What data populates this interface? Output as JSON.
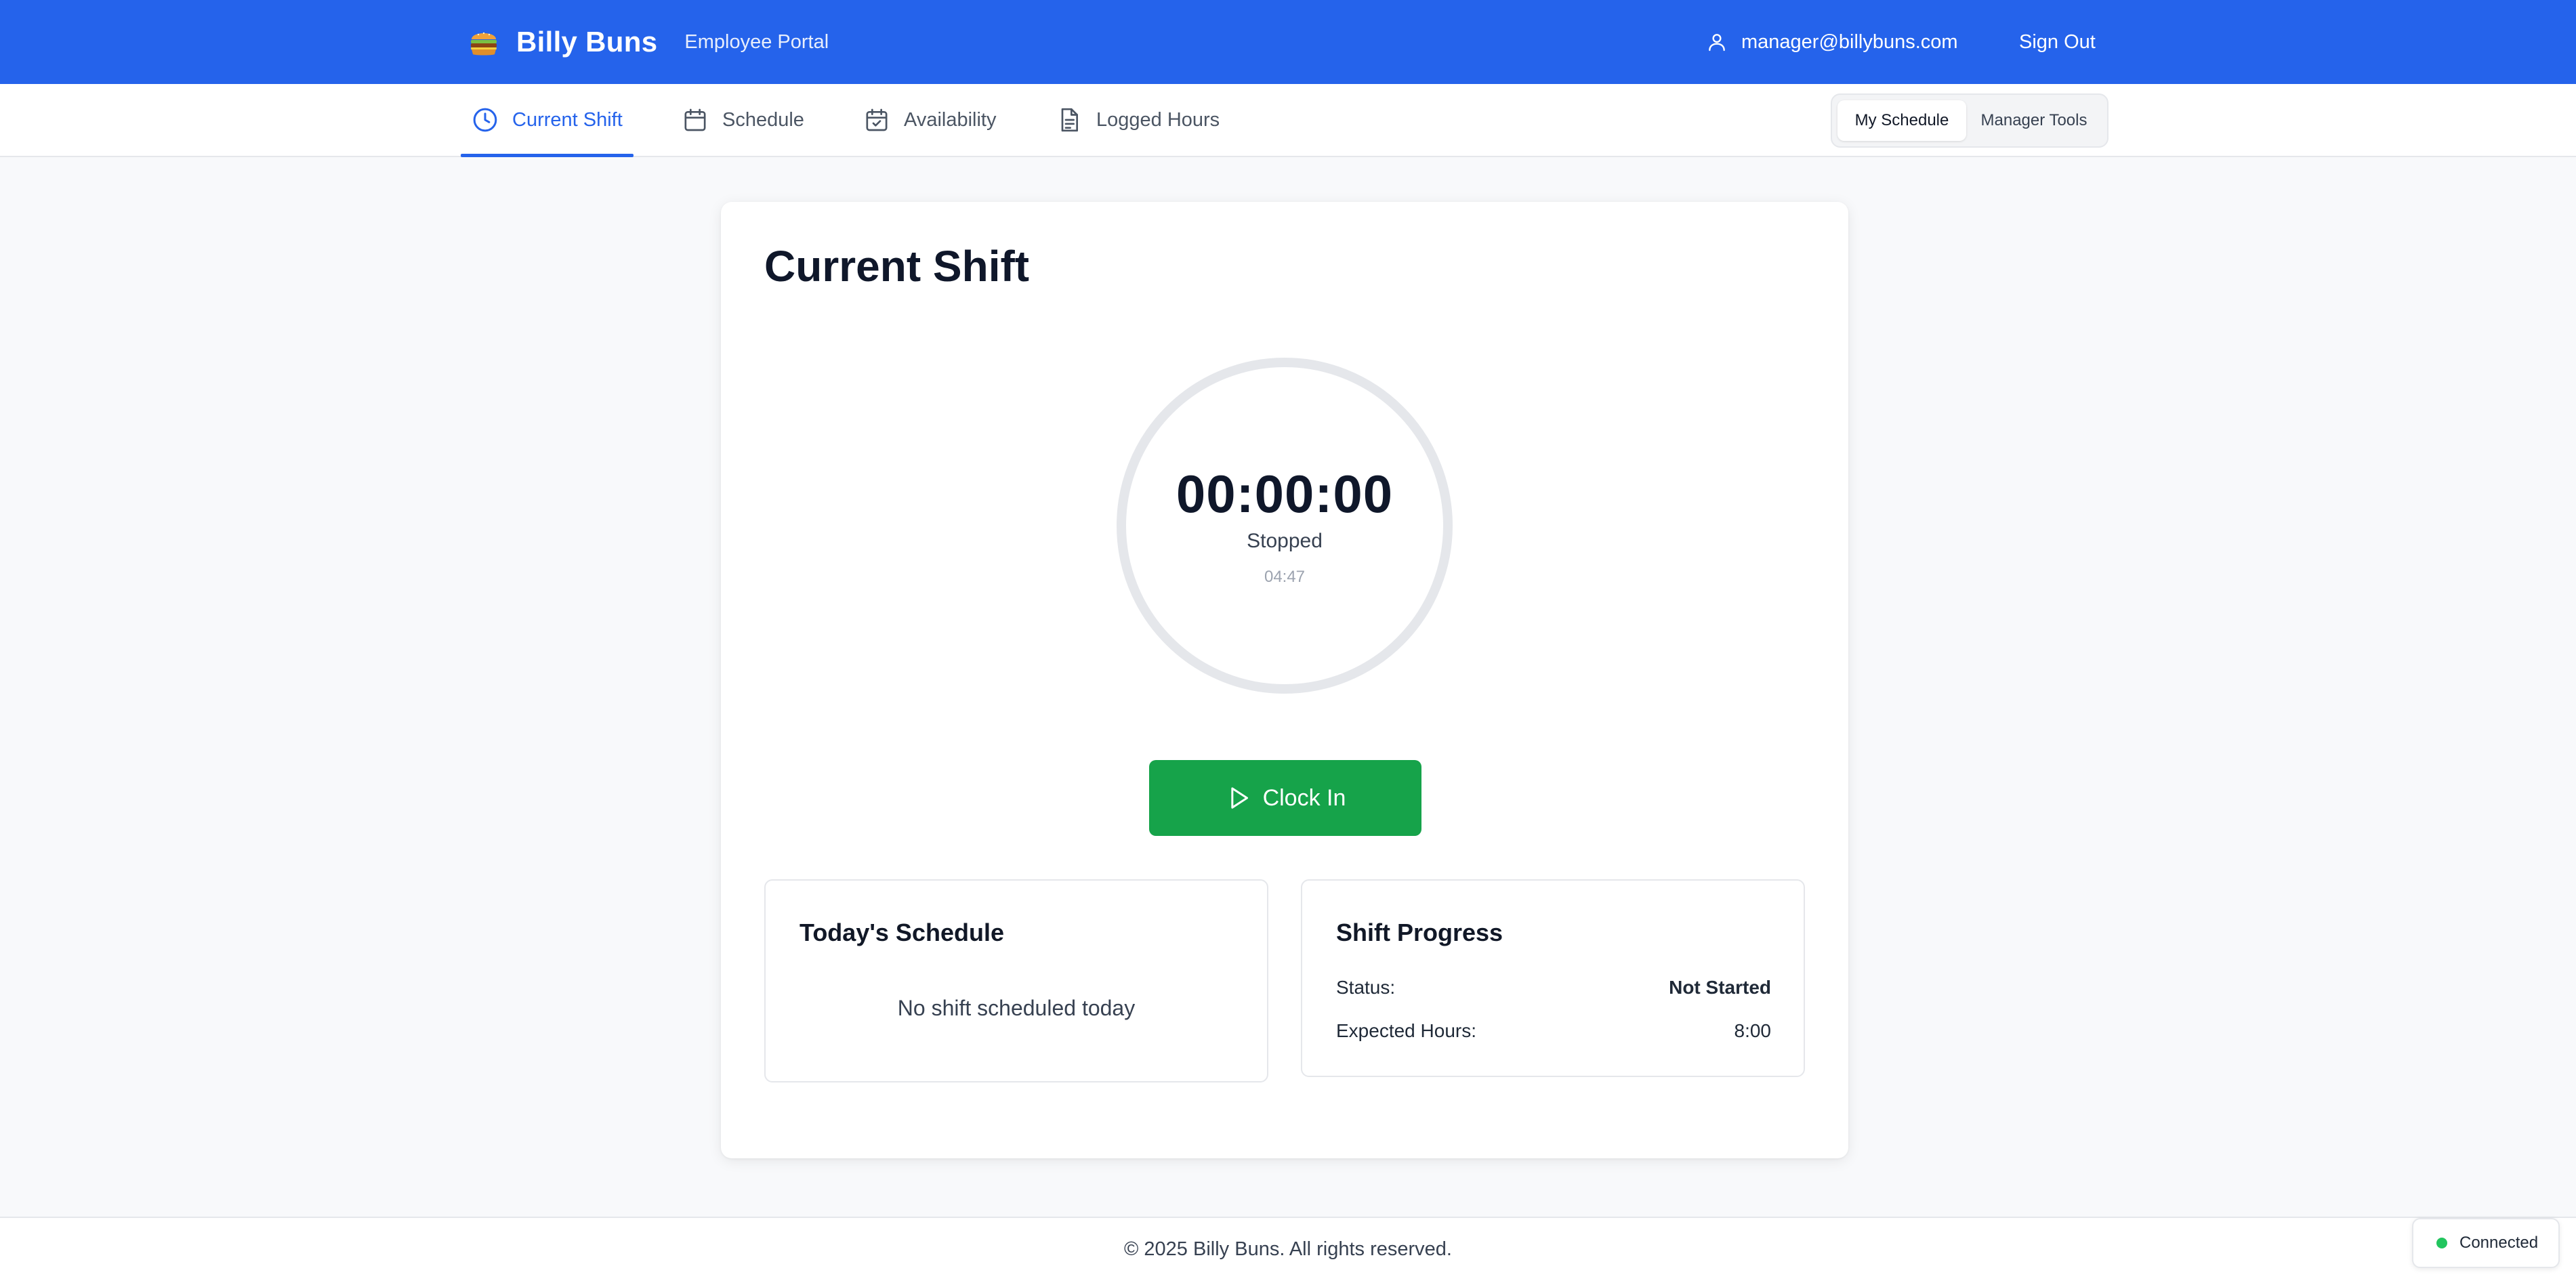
{
  "header": {
    "brand_name": "Billy Buns",
    "subtitle": "Employee Portal",
    "user_email": "manager@billybuns.com",
    "sign_out": "Sign Out",
    "logo_icon": "burger-icon",
    "user_icon": "user-icon"
  },
  "nav": {
    "tabs": [
      {
        "label": "Current Shift",
        "icon": "clock-icon",
        "active": true
      },
      {
        "label": "Schedule",
        "icon": "calendar-icon",
        "active": false
      },
      {
        "label": "Availability",
        "icon": "calendar-check-icon",
        "active": false
      },
      {
        "label": "Logged Hours",
        "icon": "document-icon",
        "active": false
      }
    ],
    "view_toggle": {
      "options": [
        "My Schedule",
        "Manager Tools"
      ],
      "selected": "My Schedule"
    }
  },
  "main": {
    "title": "Current Shift",
    "timer": {
      "value": "00:00:00",
      "status": "Stopped",
      "clock": "04:47"
    },
    "clock_in_label": "Clock In",
    "todays_schedule": {
      "title": "Today's Schedule",
      "empty_message": "No shift scheduled today"
    },
    "shift_progress": {
      "title": "Shift Progress",
      "rows": [
        {
          "label": "Status:",
          "value": "Not Started"
        },
        {
          "label": "Expected Hours:",
          "value": "8:00"
        }
      ]
    }
  },
  "footer": {
    "copyright": "© 2025 Billy Buns. All rights reserved."
  },
  "connection": {
    "label": "Connected",
    "color": "#22c55e"
  },
  "colors": {
    "brand_blue": "#2563eb",
    "clock_in_green": "#16a34a",
    "page_bg": "#f8f9fb"
  }
}
